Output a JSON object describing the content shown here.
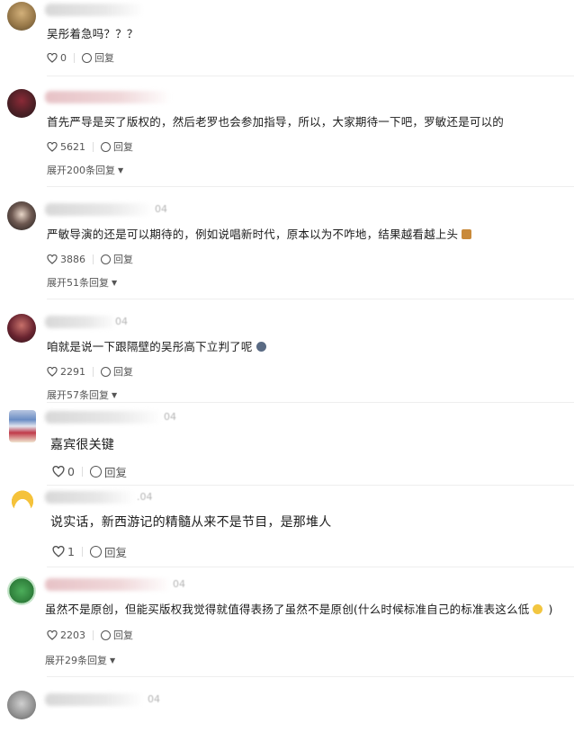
{
  "comments": [
    {
      "text": "吴彤着急吗？？？",
      "likes": "0",
      "reply_label": "回复",
      "expand": ""
    },
    {
      "text": "首先严导是买了版权的，然后老罗也会参加指导，所以，大家期待一下吧，罗敏还是可以的",
      "likes": "5621",
      "reply_label": "回复",
      "expand": "展开200条回复"
    },
    {
      "date": "04",
      "text": "严敏导演的还是可以期待的，例如说唱新时代，原本以为不咋地，结果越看越上头",
      "likes": "3886",
      "reply_label": "回复",
      "expand": "展开51条回复"
    },
    {
      "date": "04",
      "text": "咱就是说一下跟隔壁的吴彤高下立判了呢",
      "likes": "2291",
      "reply_label": "回复",
      "expand": "展开57条回复"
    },
    {
      "date": "04",
      "text": "嘉宾很关键",
      "likes": "0",
      "reply_label": "回复",
      "expand": ""
    },
    {
      "date": ".04",
      "text": "说实话，新西游记的精髓从来不是节目，是那堆人",
      "likes": "1",
      "reply_label": "回复",
      "expand": ""
    },
    {
      "date": "04",
      "text": "虽然不是原创，但能买版权我觉得就值得表扬了虽然不是原创(什么时候标准自己的标准表这么低",
      "text_tail": ")",
      "likes": "2203",
      "reply_label": "回复",
      "expand": "展开29条回复"
    },
    {
      "date": "04"
    }
  ],
  "colors": {
    "text": "#1c1c1c",
    "meta": "#555555",
    "divider": "#eeeeee"
  },
  "icons": [
    "heart-icon",
    "comment-icon",
    "caret-down-icon"
  ]
}
